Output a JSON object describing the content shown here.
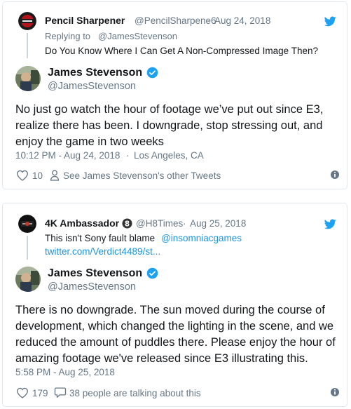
{
  "colors": {
    "link_blue": "#1b95e0",
    "secondary_text": "#657786",
    "primary_text": "#14171a",
    "border": "#e1e8ed"
  },
  "tweets": [
    {
      "reply": {
        "name": "Pencil Sharpener",
        "handle": "@PencilSharpene6",
        "separator": "·",
        "date": "Aug 24, 2018",
        "replying_prefix": "Replying to",
        "replying_to": "@JamesStevenson",
        "text": "Do You Know Where I Can Get A Non-Compressed Image Then?"
      },
      "author": {
        "name": "James Stevenson",
        "handle": "@JamesStevenson"
      },
      "body_lines": [
        "No just go watch the hour of footage we’ve put out since E3,",
        "realize there has been. I downgrade, stop stressing out, and",
        "enjoy the game in two weeks"
      ],
      "timestamp": "10:12 PM - Aug 24, 2018",
      "location_separator": "·",
      "location": "Los Angeles, CA",
      "likes": "10",
      "secondary_action": "See James Stevenson's other Tweets"
    },
    {
      "reply": {
        "name": "4K Ambassador",
        "handle": "@H8Times",
        "separator": "·",
        "date": "Aug 25, 2018",
        "text_prefix": "This isn't Sony fault blame",
        "mention": "@insomniacgames",
        "link": "twitter.com/Verdict4489/st..."
      },
      "author": {
        "name": "James Stevenson",
        "handle": "@JamesStevenson"
      },
      "body_lines": [
        "There is no downgrade. The sun moved during the course of",
        "development, which changed the lighting in the scene, and we",
        "reduced the amount of puddles there. Please enjoy the hour of",
        "amazing footage we've released since E3 illustrating this."
      ],
      "timestamp": "5:58 PM - Aug 25, 2018",
      "likes": "179",
      "secondary_action": "38 people are talking about this"
    }
  ]
}
